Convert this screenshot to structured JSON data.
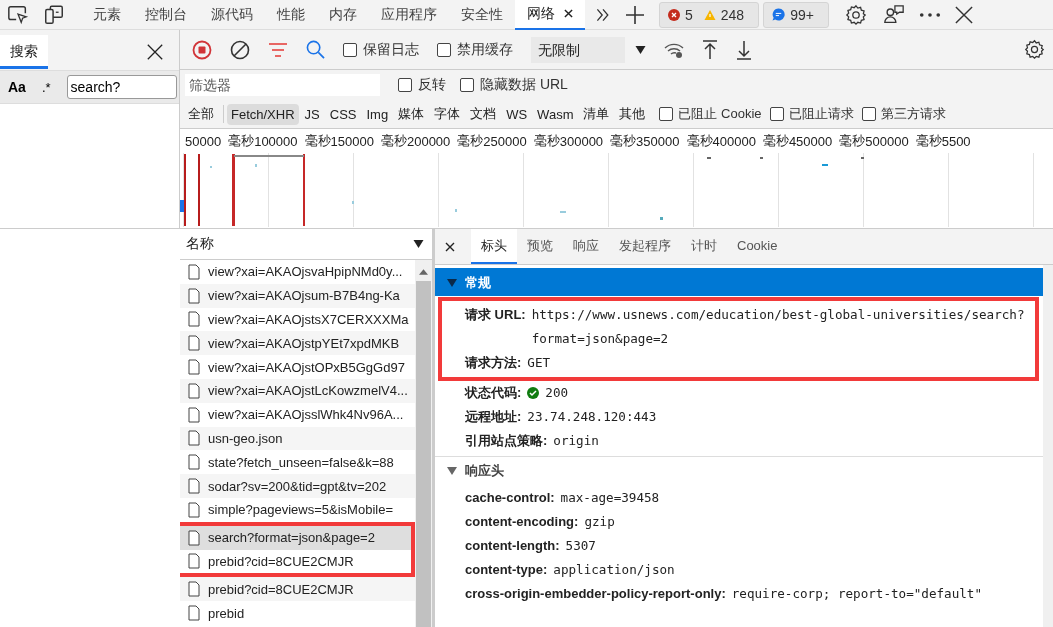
{
  "top_bar": {
    "tabs": [
      {
        "label": "元素",
        "selected": false
      },
      {
        "label": "控制台",
        "selected": false
      },
      {
        "label": "源代码",
        "selected": false
      },
      {
        "label": "性能",
        "selected": false
      },
      {
        "label": "内存",
        "selected": false
      },
      {
        "label": "应用程序",
        "selected": false
      },
      {
        "label": "安全性",
        "selected": false
      },
      {
        "label": "网络",
        "selected": true
      }
    ],
    "error_count": "5",
    "warning_count": "248",
    "message_count": "99+"
  },
  "search_panel": {
    "tab": "搜索",
    "case_toggle": "Aa",
    "regex_toggle": ".*",
    "query": "search?"
  },
  "network_toolbar": {
    "checkboxes": [
      {
        "label": "保留日志",
        "checked": false
      },
      {
        "label": "禁用缓存",
        "checked": false
      }
    ],
    "throttling": "无限制"
  },
  "filter_bar": {
    "placeholder": "筛选器",
    "checkboxes": [
      {
        "label": "反转",
        "checked": false
      },
      {
        "label": "隐藏数据 URL",
        "checked": false
      }
    ]
  },
  "type_filters": [
    {
      "label": "全部",
      "selected": false
    },
    {
      "label": "Fetch/XHR",
      "selected": true
    },
    {
      "label": "JS",
      "selected": false
    },
    {
      "label": "CSS",
      "selected": false
    },
    {
      "label": "Img",
      "selected": false
    },
    {
      "label": "媒体",
      "selected": false
    },
    {
      "label": "字体",
      "selected": false
    },
    {
      "label": "文档",
      "selected": false
    },
    {
      "label": "WS",
      "selected": false
    },
    {
      "label": "Wasm",
      "selected": false
    },
    {
      "label": "清单",
      "selected": false
    },
    {
      "label": "其他",
      "selected": false
    }
  ],
  "extra_filters": [
    {
      "label": "已阻止 Cookie",
      "checked": false
    },
    {
      "label": "已阻止请求",
      "checked": false
    },
    {
      "label": "第三方请求",
      "checked": false
    }
  ],
  "timeline": {
    "ticks": [
      "50000",
      "毫秒",
      "100000",
      "毫秒",
      "150000",
      "毫秒",
      "200000",
      "毫秒",
      "250000",
      "毫秒",
      "300000",
      "毫秒",
      "350000",
      "毫秒",
      "400000",
      "毫秒",
      "450000",
      "毫秒",
      "500000",
      "毫秒",
      "5500"
    ]
  },
  "request_list": {
    "column": "名称",
    "rows": [
      {
        "name": "view?xai=AKAOjsvaHpipNMd0y...",
        "selected": false,
        "framed": false
      },
      {
        "name": "view?xai=AKAOjsum-B7B4ng-Ka",
        "selected": false,
        "framed": false
      },
      {
        "name": "view?xai=AKAOjstsX7CERXXXMa",
        "selected": false,
        "framed": false
      },
      {
        "name": "view?xai=AKAOjstpYEt7xpdMKB",
        "selected": false,
        "framed": false
      },
      {
        "name": "view?xai=AKAOjstOPxB5GgGd97",
        "selected": false,
        "framed": false
      },
      {
        "name": "view?xai=AKAOjstLcKowzmelV4...",
        "selected": false,
        "framed": false
      },
      {
        "name": "view?xai=AKAOjsslWhk4Nv96A...",
        "selected": false,
        "framed": false
      },
      {
        "name": "usn-geo.json",
        "selected": false,
        "framed": false
      },
      {
        "name": "state?fetch_unseen=false&k=88",
        "selected": false,
        "framed": false
      },
      {
        "name": "sodar?sv=200&tid=gpt&tv=202",
        "selected": false,
        "framed": false
      },
      {
        "name": "simple?pageviews=5&isMobile=",
        "selected": false,
        "framed": false
      },
      {
        "name": "search?format=json&page=2",
        "selected": true,
        "framed": true
      },
      {
        "name": "prebid?cid=8CUE2CMJR",
        "selected": false,
        "framed": true
      },
      {
        "name": "prebid?cid=8CUE2CMJR",
        "selected": false,
        "framed": false
      },
      {
        "name": "prebid",
        "selected": false,
        "framed": false
      }
    ]
  },
  "details": {
    "tabs": [
      {
        "label": "标头",
        "selected": true
      },
      {
        "label": "预览",
        "selected": false
      },
      {
        "label": "响应",
        "selected": false
      },
      {
        "label": "发起程序",
        "selected": false
      },
      {
        "label": "计时",
        "selected": false
      },
      {
        "label": "Cookie",
        "selected": false
      }
    ],
    "sections": [
      {
        "title": "常规",
        "expanded": true,
        "highlighted": true,
        "rows": [
          {
            "kind": "text",
            "key": "请求 URL:",
            "value": "https://www.usnews.com/education/best-global-universities/search?format=json&page=2",
            "framed": true
          },
          {
            "kind": "text",
            "key": "请求方法:",
            "value": "GET",
            "framed": true
          },
          {
            "kind": "status",
            "key": "状态代码:",
            "value": "200",
            "framed": false
          },
          {
            "kind": "text",
            "key": "远程地址:",
            "value": "23.74.248.120:443",
            "framed": false
          },
          {
            "kind": "text",
            "key": "引用站点策略:",
            "value": "origin",
            "framed": false
          }
        ]
      },
      {
        "title": "响应头",
        "expanded": true,
        "highlighted": false,
        "rows": [
          {
            "kind": "text",
            "key": "cache-control:",
            "value": "max-age=39458",
            "framed": false
          },
          {
            "kind": "text",
            "key": "content-encoding:",
            "value": "gzip",
            "framed": false
          },
          {
            "kind": "text",
            "key": "content-length:",
            "value": "5307",
            "framed": false
          },
          {
            "kind": "text",
            "key": "content-type:",
            "value": "application/json",
            "framed": false
          },
          {
            "kind": "text",
            "key": "cross-origin-embedder-policy-report-only:",
            "value": "require-corp; report-to=\"default\"",
            "framed": false
          }
        ]
      }
    ]
  }
}
